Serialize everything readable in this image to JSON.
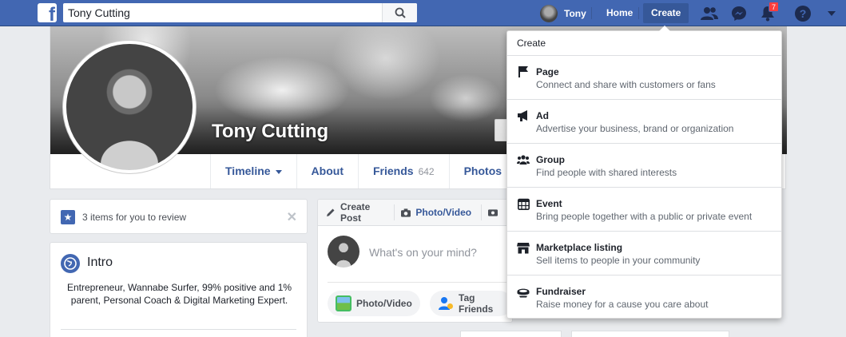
{
  "topbar": {
    "search_value": "Tony Cutting",
    "profile_name": "Tony",
    "home_label": "Home",
    "create_label": "Create",
    "notification_count": "7",
    "brand_color": "#4267b2"
  },
  "profile": {
    "name": "Tony Cutting",
    "tabs": [
      {
        "label": "Timeline"
      },
      {
        "label": "About"
      },
      {
        "label": "Friends",
        "count": "642"
      },
      {
        "label": "Photos"
      }
    ]
  },
  "review": {
    "text": "3 items for you to review",
    "close": "✕"
  },
  "intro": {
    "title": "Intro",
    "bio": "Entrepreneur, Wannabe Surfer,  99% positive and 1% parent, Personal Coach & Digital Marketing Expert."
  },
  "composer": {
    "tabs": [
      {
        "label": "Create Post"
      },
      {
        "label": "Photo/Video"
      }
    ],
    "placeholder": "What's on your mind?",
    "actions": [
      {
        "label": "Photo/Video"
      },
      {
        "label": "Tag Friends"
      }
    ]
  },
  "dropdown": {
    "header": "Create",
    "items": [
      {
        "title": "Page",
        "desc": "Connect and share with customers or fans",
        "icon": "flag-icon"
      },
      {
        "title": "Ad",
        "desc": "Advertise your business, brand or organization",
        "icon": "megaphone-icon"
      },
      {
        "title": "Group",
        "desc": "Find people with shared interests",
        "icon": "group-icon"
      },
      {
        "title": "Event",
        "desc": "Bring people together with a public or private event",
        "icon": "calendar-icon"
      },
      {
        "title": "Marketplace listing",
        "desc": "Sell items to people in your community",
        "icon": "shop-icon"
      },
      {
        "title": "Fundraiser",
        "desc": "Raise money for a cause you care about",
        "icon": "fundraiser-icon"
      }
    ]
  }
}
